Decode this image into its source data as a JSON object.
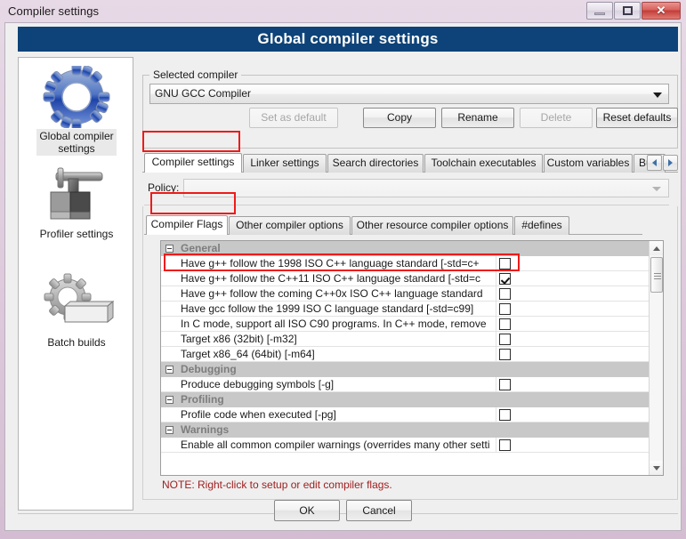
{
  "window": {
    "title": "Compiler settings",
    "banner": "Global compiler settings",
    "minimize_label": "",
    "maximize_label": "",
    "close_label": "✕"
  },
  "sidebar": {
    "items": [
      {
        "label": "Global compiler\nsettings",
        "icon": "gear-icon",
        "selected": true
      },
      {
        "label": "Profiler settings",
        "icon": "profiler-icon",
        "selected": false
      },
      {
        "label": "Batch builds",
        "icon": "batch-builds-icon",
        "selected": false
      }
    ]
  },
  "selected_compiler": {
    "group_title": "Selected compiler",
    "value": "GNU GCC Compiler",
    "buttons": [
      {
        "label": "Set as default",
        "disabled": true
      },
      {
        "label": "Copy",
        "disabled": false
      },
      {
        "label": "Rename",
        "disabled": false
      },
      {
        "label": "Delete",
        "disabled": true
      },
      {
        "label": "Reset defaults",
        "disabled": false
      }
    ]
  },
  "outer_tabs": {
    "items": [
      {
        "label": "Compiler settings",
        "active": true
      },
      {
        "label": "Linker settings",
        "active": false
      },
      {
        "label": "Search directories",
        "active": false
      },
      {
        "label": "Toolchain executables",
        "active": false
      },
      {
        "label": "Custom variables",
        "active": false
      },
      {
        "label": "Bui",
        "active": false
      }
    ],
    "scroll_left": "◀",
    "scroll_right": "▶"
  },
  "policy": {
    "label": "Policy:",
    "value": ""
  },
  "inner_tabs": {
    "items": [
      {
        "label": "Compiler Flags",
        "active": true
      },
      {
        "label": "Other compiler options",
        "active": false
      },
      {
        "label": "Other resource compiler options",
        "active": false
      },
      {
        "label": "#defines",
        "active": false
      }
    ]
  },
  "flags_list": {
    "rows": [
      {
        "type": "group",
        "label": "General"
      },
      {
        "type": "item",
        "label": "Have g++ follow the 1998 ISO C++ language standard  [-std=c+",
        "checked": false
      },
      {
        "type": "item",
        "label": "Have g++ follow the C++11 ISO C++ language standard  [-std=c",
        "checked": true,
        "highlighted": true
      },
      {
        "type": "item",
        "label": "Have g++ follow the coming C++0x ISO C++ language standard",
        "checked": false
      },
      {
        "type": "item",
        "label": "Have gcc follow the 1999 ISO C language standard  [-std=c99]",
        "checked": false
      },
      {
        "type": "item",
        "label": "In C mode, support all ISO C90 programs. In C++ mode, remove",
        "checked": false
      },
      {
        "type": "item",
        "label": "Target x86 (32bit)  [-m32]",
        "checked": false
      },
      {
        "type": "item",
        "label": "Target x86_64 (64bit)  [-m64]",
        "checked": false
      },
      {
        "type": "group",
        "label": "Debugging"
      },
      {
        "type": "item",
        "label": "Produce debugging symbols  [-g]",
        "checked": false
      },
      {
        "type": "group",
        "label": "Profiling"
      },
      {
        "type": "item",
        "label": "Profile code when executed  [-pg]",
        "checked": false
      },
      {
        "type": "group",
        "label": "Warnings"
      },
      {
        "type": "item",
        "label": "Enable all common compiler warnings (overrides many other setti",
        "checked": false
      }
    ]
  },
  "note": "NOTE: Right-click to setup or edit compiler flags.",
  "dialog_buttons": {
    "ok": "OK",
    "cancel": "Cancel"
  },
  "colors": {
    "banner_bg": "#0d4378",
    "annotation": "#ee1b18",
    "note_text": "#a02020",
    "close_button": "#c43c38"
  }
}
